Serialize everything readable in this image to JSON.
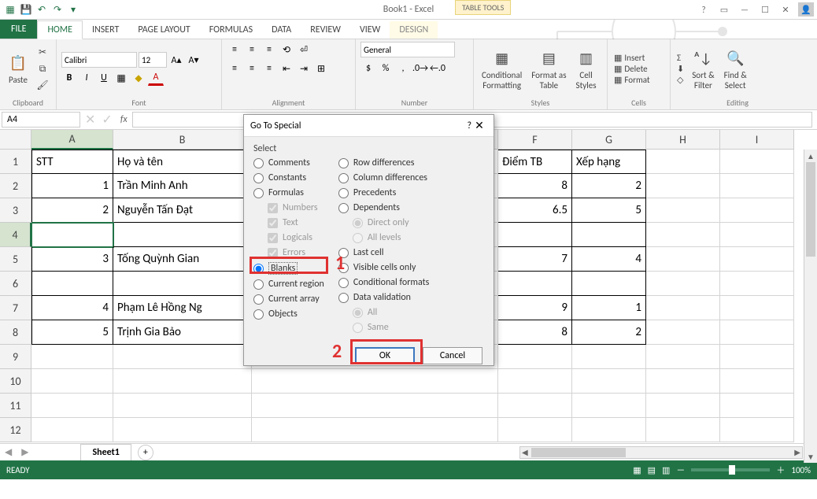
{
  "app": {
    "title": "Book1 - Excel",
    "tabletools": "TABLE TOOLS"
  },
  "qat": {
    "save": "💾",
    "undo": "↶",
    "redo": "↷"
  },
  "tabs": {
    "file": "FILE",
    "home": "HOME",
    "insert": "INSERT",
    "pagelayout": "PAGE LAYOUT",
    "formulas": "FORMULAS",
    "data": "DATA",
    "review": "REVIEW",
    "view": "VIEW",
    "design": "DESIGN"
  },
  "ribbon": {
    "clipboard": {
      "label": "Clipboard",
      "paste": "Paste"
    },
    "font": {
      "label": "Font",
      "name": "Calibri",
      "size": "12",
      "bold": "B",
      "italic": "I",
      "underline": "U"
    },
    "alignment": {
      "label": "Alignment"
    },
    "number": {
      "label": "Number",
      "format": "General"
    },
    "styles": {
      "label": "Styles",
      "conditional": "Conditional\nFormatting",
      "formatas": "Format as\nTable",
      "cellstyles": "Cell\nStyles"
    },
    "cells": {
      "label": "Cells",
      "insert": "Insert",
      "delete": "Delete",
      "format": "Format"
    },
    "editing": {
      "label": "Editing",
      "sort": "Sort &\nFilter",
      "find": "Find &\nSelect",
      "autosum": "Σ",
      "fill": "⬇",
      "clear": "◇"
    }
  },
  "namebox": "A4",
  "columns": [
    "A",
    "B",
    "F",
    "G",
    "H",
    "I"
  ],
  "rows": [
    "1",
    "2",
    "3",
    "4",
    "5",
    "6",
    "7",
    "8",
    "9",
    "10",
    "11",
    "12"
  ],
  "table": {
    "header": {
      "A": "STT",
      "B": "Họ và tên",
      "F": "Điểm TB",
      "G": "Xếp hạng"
    },
    "r2": {
      "A": "1",
      "B": "Trần Minh Anh",
      "F": "8",
      "G": "2"
    },
    "r3": {
      "A": "2",
      "B": "Nguyễn Tấn Đạt",
      "F": "6.5",
      "G": "5"
    },
    "r4": {
      "A": "",
      "B": "",
      "F": "",
      "G": ""
    },
    "r5": {
      "A": "3",
      "B": "Tống Quỳnh Gian",
      "F": "7",
      "G": "4"
    },
    "r6": {
      "A": "",
      "B": "",
      "F": "",
      "G": ""
    },
    "r7": {
      "A": "4",
      "B": "Phạm Lê Hồng Ng",
      "F": "9",
      "G": "1"
    },
    "r8": {
      "A": "5",
      "B": "Trịnh Gia Bảo",
      "F": "8",
      "G": "2"
    }
  },
  "dialog": {
    "title": "Go To Special",
    "section": "Select",
    "left": {
      "comments": "Comments",
      "constants": "Constants",
      "formulas": "Formulas",
      "numbers": "Numbers",
      "text": "Text",
      "logicals": "Logicals",
      "errors": "Errors",
      "blanks": "Blanks",
      "currentregion": "Current region",
      "currentarray": "Current array",
      "objects": "Objects"
    },
    "right": {
      "rowdiff": "Row differences",
      "coldiff": "Column differences",
      "precedents": "Precedents",
      "dependents": "Dependents",
      "directonly": "Direct only",
      "alllevels": "All levels",
      "lastcell": "Last cell",
      "visible": "Visible cells only",
      "condfmt": "Conditional formats",
      "datavalid": "Data validation",
      "all": "All",
      "same": "Same"
    },
    "ok": "OK",
    "cancel": "Cancel"
  },
  "annotations": {
    "one": "1",
    "two": "2"
  },
  "sheet": {
    "name": "Sheet1",
    "add": "+"
  },
  "status": {
    "ready": "READY",
    "zoom": "100%"
  }
}
